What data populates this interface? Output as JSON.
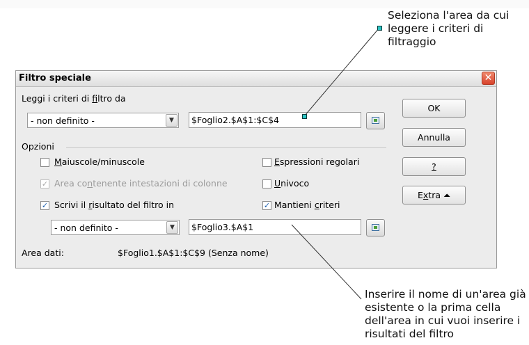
{
  "callouts": {
    "top_lines": [
      "Seleziona l'area da cui",
      "leggere i criteri di",
      "filtraggio"
    ],
    "bottom_lines": [
      "Inserire il nome di un'area già",
      "esistente o la prima cella",
      "dell'area in cui vuoi inserire i",
      "risultati del filtro"
    ]
  },
  "dialog": {
    "title": "Filtro speciale",
    "close_glyph": "✕",
    "criteria_label_pre": "Leggi i criteri di ",
    "criteria_label_u": "f",
    "criteria_label_post": "iltro da",
    "criteria_combo_value": "- non definito -",
    "criteria_field_value": "$Foglio2.$A$1:$C$4",
    "options_label": "Opzioni",
    "opt_case_u": "M",
    "opt_case_rest": "aiuscole/minuscole",
    "opt_regex_u": "E",
    "opt_regex_rest": "spressioni regolari",
    "opt_header_pre": "Area co",
    "opt_header_u": "n",
    "opt_header_post": "tenente intestazioni di colonne",
    "opt_unique_u": "U",
    "opt_unique_rest": "nivoco",
    "opt_output_pre": "Scrivi il ",
    "opt_output_u": "r",
    "opt_output_post": "isultato del filtro in",
    "opt_keep_pre": "Mantieni ",
    "opt_keep_u": "c",
    "opt_keep_post": "riteri",
    "output_combo_value": "- non definito -",
    "output_field_value": "$Foglio3.$A$1",
    "data_area_label": "Area dati:",
    "data_area_value": "$Foglio1.$A$1:$C$9 (Senza nome)",
    "buttons": {
      "ok": "OK",
      "cancel": "Annulla",
      "help": "?",
      "extra_pre": "E",
      "extra_u": "x",
      "extra_post": "tra",
      "extra_icon": "⏶"
    },
    "checks": {
      "case": false,
      "regex": false,
      "header": true,
      "unique": false,
      "output": true,
      "keep": true
    }
  }
}
